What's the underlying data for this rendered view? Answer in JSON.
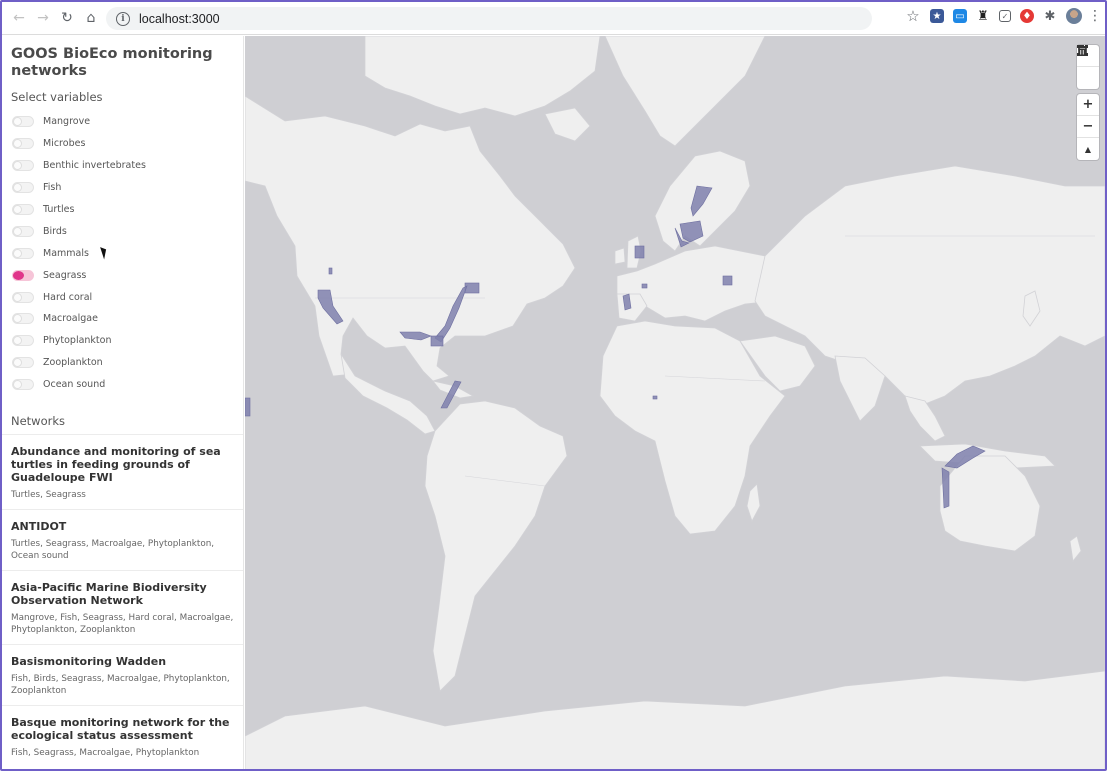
{
  "browser": {
    "url": "localhost:3000",
    "nav": {
      "back_icon": "arrow-left-icon",
      "forward_icon": "arrow-right-icon",
      "reload_icon": "reload-icon",
      "home_icon": "home-icon"
    },
    "extensions": [
      "star-icon",
      "bookmark-extension-icon",
      "window-extension-icon",
      "hat-extension-icon",
      "pocket-icon",
      "red-extension-icon",
      "puzzle-icon",
      "profile-avatar",
      "kebab-menu-icon"
    ]
  },
  "sidebar": {
    "title": "GOOS BioEco monitoring networks",
    "select_label": "Select variables",
    "variables": [
      {
        "label": "Mangrove",
        "on": false
      },
      {
        "label": "Microbes",
        "on": false
      },
      {
        "label": "Benthic invertebrates",
        "on": false
      },
      {
        "label": "Fish",
        "on": false
      },
      {
        "label": "Turtles",
        "on": false
      },
      {
        "label": "Birds",
        "on": false
      },
      {
        "label": "Mammals",
        "on": false
      },
      {
        "label": "Seagrass",
        "on": true
      },
      {
        "label": "Hard coral",
        "on": false
      },
      {
        "label": "Macroalgae",
        "on": false
      },
      {
        "label": "Phytoplankton",
        "on": false
      },
      {
        "label": "Zooplankton",
        "on": false
      },
      {
        "label": "Ocean sound",
        "on": false
      }
    ],
    "networks_label": "Networks",
    "networks": [
      {
        "title": "Abundance and monitoring of sea turtles in feeding grounds of Guadeloupe FWI",
        "vars": "Turtles, Seagrass"
      },
      {
        "title": "ANTIDOT",
        "vars": "Turtles, Seagrass, Macroalgae, Phytoplankton, Ocean sound"
      },
      {
        "title": "Asia-Pacific Marine Biodiversity Observation Network",
        "vars": "Mangrove, Fish, Seagrass, Hard coral, Macroalgae, Phytoplankton, Zooplankton"
      },
      {
        "title": "Basismonitoring Wadden",
        "vars": "Fish, Birds, Seagrass, Macroalgae, Phytoplankton, Zooplankton"
      },
      {
        "title": "Basque monitoring network for the ecological status assessment",
        "vars": "Fish, Seagrass, Macroalgae, Phytoplankton"
      }
    ]
  },
  "map_controls": {
    "draw": [
      "polygon-draw-icon",
      "trash-icon"
    ],
    "zoom": [
      {
        "icon": "zoom-in-icon",
        "glyph": "+"
      },
      {
        "icon": "zoom-out-icon",
        "glyph": "−"
      },
      {
        "icon": "compass-icon",
        "glyph": "▲"
      }
    ]
  },
  "colors": {
    "accent": "#e0358a",
    "ocean": "#cfcfd3",
    "land": "#efefef",
    "highlight": "#7f80ad",
    "frame": "#6f5fc7"
  }
}
